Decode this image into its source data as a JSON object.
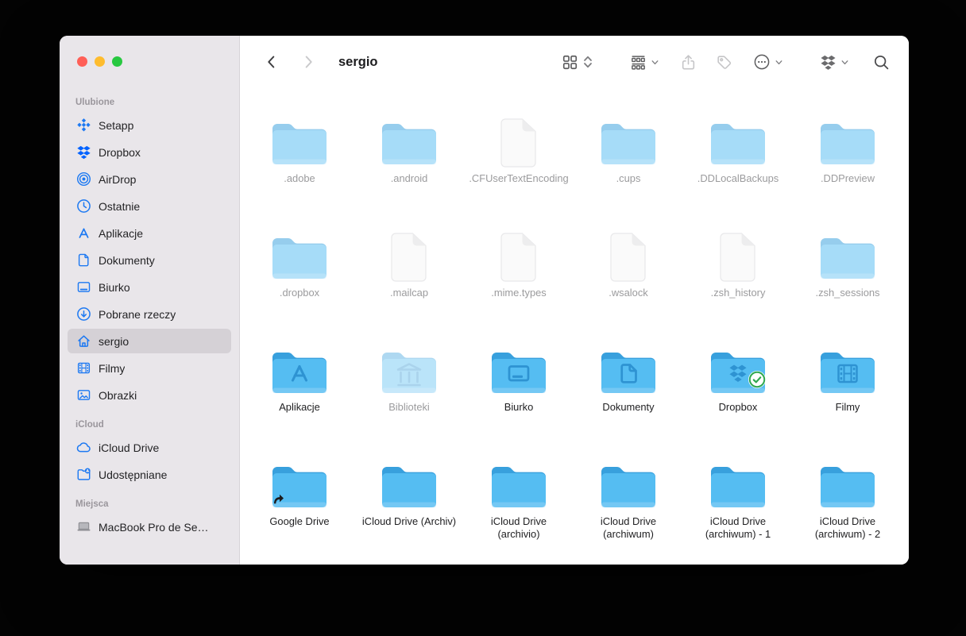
{
  "window": {
    "title": "sergio"
  },
  "toolbar": {
    "title": "sergio",
    "icons": [
      "chevron-left-icon",
      "chevron-right-icon",
      "icon-view-icon",
      "sort-chevrons-icon",
      "group-by-icon",
      "share-icon",
      "tag-icon",
      "more-circle-icon",
      "chevron-down-icon",
      "dropbox-icon",
      "search-icon"
    ]
  },
  "sidebar": {
    "sections": [
      {
        "label": "Ulubione",
        "items": [
          {
            "label": "Setapp",
            "icon": "setapp-icon"
          },
          {
            "label": "Dropbox",
            "icon": "dropbox-icon"
          },
          {
            "label": "AirDrop",
            "icon": "airdrop-icon"
          },
          {
            "label": "Ostatnie",
            "icon": "clock-icon"
          },
          {
            "label": "Aplikacje",
            "icon": "appstore-icon"
          },
          {
            "label": "Dokumenty",
            "icon": "document-icon"
          },
          {
            "label": "Biurko",
            "icon": "desktop-icon"
          },
          {
            "label": "Pobrane rzeczy",
            "icon": "download-icon"
          },
          {
            "label": "sergio",
            "icon": "home-icon",
            "selected": true
          },
          {
            "label": "Filmy",
            "icon": "film-icon"
          },
          {
            "label": "Obrazki",
            "icon": "photo-icon"
          }
        ]
      },
      {
        "label": "iCloud",
        "items": [
          {
            "label": "iCloud Drive",
            "icon": "cloud-icon"
          },
          {
            "label": "Udostępniane",
            "icon": "shared-folder-icon"
          }
        ]
      },
      {
        "label": "Miejsca",
        "items": [
          {
            "label": "MacBook Pro de Se…",
            "icon": "laptop-icon",
            "gray": true
          }
        ]
      }
    ]
  },
  "files": {
    "items": [
      {
        "name": ".adobe",
        "type": "folder",
        "hidden": true
      },
      {
        "name": ".android",
        "type": "folder",
        "hidden": true
      },
      {
        "name": ".CFUserTextEncoding",
        "type": "file",
        "hidden": true
      },
      {
        "name": ".cups",
        "type": "folder",
        "hidden": true
      },
      {
        "name": ".DDLocalBackups",
        "type": "folder",
        "hidden": true
      },
      {
        "name": ".DDPreview",
        "type": "folder",
        "hidden": true
      },
      {
        "name": ".dropbox",
        "type": "folder",
        "hidden": true
      },
      {
        "name": ".mailcap",
        "type": "file",
        "hidden": true
      },
      {
        "name": ".mime.types",
        "type": "file",
        "hidden": true
      },
      {
        "name": ".wsalock",
        "type": "file",
        "hidden": true
      },
      {
        "name": ".zsh_history",
        "type": "file",
        "hidden": true
      },
      {
        "name": ".zsh_sessions",
        "type": "folder",
        "hidden": true
      },
      {
        "name": "Aplikacje",
        "type": "folder",
        "glyph": "appstore"
      },
      {
        "name": "Biblioteki",
        "type": "folder",
        "glyph": "library",
        "disabled": true
      },
      {
        "name": "Biurko",
        "type": "folder",
        "glyph": "desktop"
      },
      {
        "name": "Dokumenty",
        "type": "folder",
        "glyph": "document"
      },
      {
        "name": "Dropbox",
        "type": "folder",
        "glyph": "dropbox",
        "badge": "synced-check"
      },
      {
        "name": "Filmy",
        "type": "folder",
        "glyph": "film"
      },
      {
        "name": "Google Drive",
        "type": "folder",
        "badge": "alias-arrow"
      },
      {
        "name": "iCloud Drive (Archiv)",
        "type": "folder"
      },
      {
        "name": "iCloud Drive (archivio)",
        "type": "folder"
      },
      {
        "name": "iCloud Drive (archiwum)",
        "type": "folder"
      },
      {
        "name": "iCloud Drive (archiwum) - 1",
        "type": "folder"
      },
      {
        "name": "iCloud Drive (archiwum) - 2",
        "type": "folder"
      }
    ]
  },
  "colors": {
    "accent_blue": "#1d79f2",
    "dropbox_blue": "#0062ff",
    "folder_body": "#55bdf2",
    "folder_tab": "#38a0dd",
    "folder_glyph": "#2e93d2",
    "sidebar_bg": "#e9e6ea",
    "selection_bg": "#d5d1d6",
    "label_dark": "#1f1f21",
    "label_muted": "#9b9b9d",
    "badge_green": "#2fa84f",
    "traffic_red": "#ff5f57",
    "traffic_yellow": "#febc2e",
    "traffic_green": "#28c840"
  }
}
